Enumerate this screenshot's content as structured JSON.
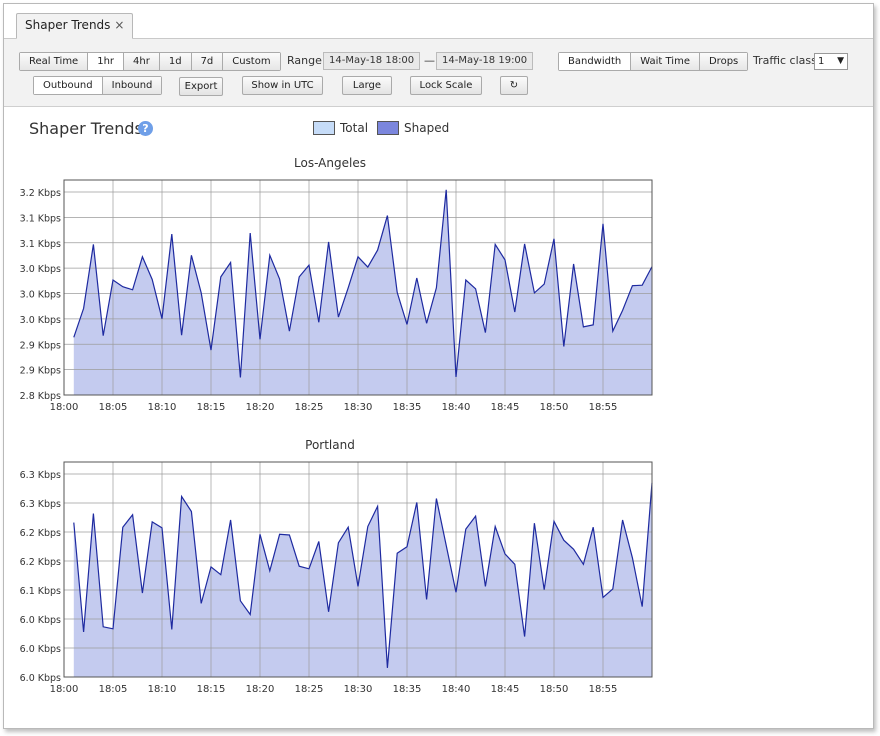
{
  "tab": {
    "label": "Shaper Trends",
    "close_glyph": "×"
  },
  "toolbar": {
    "time_ranges": [
      "Real Time",
      "1hr",
      "4hr",
      "1d",
      "7d",
      "Custom"
    ],
    "active_time_range": "1hr",
    "range_label": "Range",
    "range_from": "14-May-18 18:00",
    "range_sep": "—",
    "range_to": "14-May-18 19:00",
    "metrics": [
      "Bandwidth",
      "Wait Time",
      "Drops"
    ],
    "active_metric": "Bandwidth",
    "traffic_class_label": "Traffic class",
    "traffic_class_value": "1",
    "traffic_class_arrow": "▼",
    "directions": [
      "Outbound",
      "Inbound"
    ],
    "active_direction": "Outbound",
    "export_label": "Export",
    "utc_label": "Show in UTC",
    "large_label": "Large",
    "lock_scale_label": "Lock Scale",
    "refresh_icon": "refresh-icon",
    "refresh_glyph": "↻"
  },
  "page": {
    "title": "Shaper Trends",
    "help_glyph": "?"
  },
  "legend": [
    {
      "label": "Total",
      "color": "#c6dcf8"
    },
    {
      "label": "Shaped",
      "color": "#7b86dd"
    }
  ],
  "colors": {
    "area_fill": "#c4cbef",
    "line": "#1e2aa0",
    "grid": "#9c9c9c"
  },
  "chart_data": [
    {
      "type": "area",
      "title": "Los-Angeles",
      "x_ticks": [
        "18:00",
        "18:05",
        "18:10",
        "18:15",
        "18:20",
        "18:25",
        "18:30",
        "18:35",
        "18:40",
        "18:45",
        "18:50",
        "18:55"
      ],
      "y_tick_labels": [
        "3.2 Kbps",
        "3.1 Kbps",
        "3.1 Kbps",
        "3.0 Kbps",
        "3.0 Kbps",
        "3.0 Kbps",
        "2.9 Kbps",
        "2.9 Kbps",
        "2.8 Kbps"
      ],
      "ylim": [
        2.8,
        3.217
      ],
      "xlim": [
        0,
        60
      ],
      "series": [
        {
          "name": "Shaped",
          "x": [
            1,
            2,
            3,
            4,
            5,
            6,
            7,
            8,
            9,
            10,
            11,
            12,
            13,
            14,
            15,
            16,
            17,
            18,
            19,
            20,
            21,
            22,
            23,
            24,
            25,
            26,
            27,
            28,
            29,
            30,
            31,
            32,
            33,
            34,
            35,
            36,
            37,
            38,
            39,
            40,
            41,
            42,
            43,
            44,
            45,
            46,
            47,
            48,
            49,
            50,
            51,
            52,
            53,
            54,
            55,
            56,
            57,
            58,
            59,
            60
          ],
          "values": [
            2.912,
            2.968,
            3.092,
            2.915,
            3.023,
            3.01,
            3.004,
            3.068,
            3.024,
            2.948,
            3.112,
            2.916,
            3.071,
            2.998,
            2.887,
            3.029,
            3.057,
            2.834,
            3.114,
            2.908,
            3.071,
            3.025,
            2.924,
            3.029,
            3.052,
            2.941,
            3.097,
            2.951,
            3.008,
            3.068,
            3.048,
            3.081,
            3.148,
            2.999,
            2.937,
            3.027,
            2.939,
            3.008,
            3.198,
            2.835,
            3.023,
            3.006,
            2.921,
            3.092,
            3.062,
            2.961,
            3.093,
            2.998,
            3.015,
            3.103,
            2.894,
            3.054,
            2.932,
            2.936,
            3.132,
            2.924,
            2.964,
            3.012,
            3.013,
            3.049
          ]
        }
      ]
    },
    {
      "type": "area",
      "title": "Portland",
      "x_ticks": [
        "18:00",
        "18:05",
        "18:10",
        "18:15",
        "18:20",
        "18:25",
        "18:30",
        "18:35",
        "18:40",
        "18:45",
        "18:50",
        "18:55"
      ],
      "y_tick_labels": [
        "6.3 Kbps",
        "6.3 Kbps",
        "6.2 Kbps",
        "6.2 Kbps",
        "6.1 Kbps",
        "6.0 Kbps",
        "6.0 Kbps",
        "6.0 Kbps"
      ],
      "ylim": [
        5.97,
        6.3
      ],
      "xlim": [
        0,
        60
      ],
      "series": [
        {
          "name": "Shaped",
          "x": [
            1,
            2,
            3,
            4,
            5,
            6,
            7,
            8,
            9,
            10,
            11,
            12,
            13,
            14,
            15,
            16,
            17,
            18,
            19,
            20,
            21,
            22,
            23,
            24,
            25,
            26,
            27,
            28,
            29,
            30,
            31,
            32,
            33,
            34,
            35,
            36,
            37,
            38,
            39,
            40,
            41,
            42,
            43,
            44,
            45,
            46,
            47,
            48,
            49,
            50,
            51,
            52,
            53,
            54,
            55,
            56,
            57,
            58,
            59,
            60
          ],
          "values": [
            6.207,
            6.039,
            6.221,
            6.047,
            6.044,
            6.2,
            6.219,
            6.099,
            6.208,
            6.199,
            6.043,
            6.247,
            6.224,
            6.083,
            6.139,
            6.127,
            6.211,
            6.087,
            6.066,
            6.189,
            6.133,
            6.189,
            6.188,
            6.14,
            6.136,
            6.178,
            6.07,
            6.176,
            6.2,
            6.109,
            6.201,
            6.232,
            5.984,
            6.16,
            6.17,
            6.238,
            6.089,
            6.244,
            6.172,
            6.1,
            6.197,
            6.217,
            6.109,
            6.201,
            6.159,
            6.143,
            6.032,
            6.206,
            6.104,
            6.209,
            6.18,
            6.166,
            6.143,
            6.2,
            6.092,
            6.105,
            6.211,
            6.153,
            6.078,
            6.268
          ]
        }
      ]
    }
  ]
}
